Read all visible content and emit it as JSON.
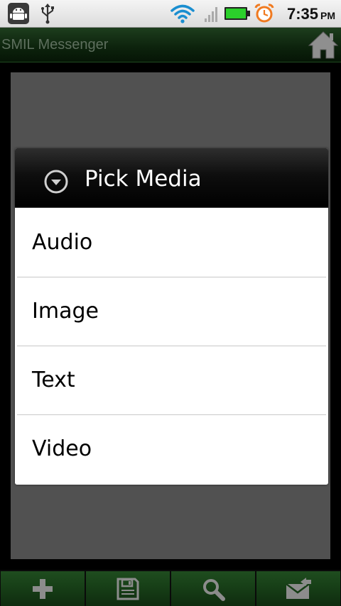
{
  "status_bar": {
    "time": "7:35",
    "ampm": "PM",
    "icons": [
      "android-debug-icon",
      "usb-icon",
      "wifi-icon",
      "signal-icon",
      "battery-icon",
      "alarm-icon"
    ]
  },
  "title_bar": {
    "title": "SMIL Messenger",
    "home_icon": "home-icon"
  },
  "dialog": {
    "title": "Pick Media",
    "icon": "dropdown-circle-icon",
    "items": [
      {
        "label": "Audio"
      },
      {
        "label": "Image"
      },
      {
        "label": "Text"
      },
      {
        "label": "Video"
      }
    ]
  },
  "bottom_bar": {
    "buttons": [
      {
        "icon": "add-icon"
      },
      {
        "icon": "save-icon"
      },
      {
        "icon": "search-icon"
      },
      {
        "icon": "send-mail-icon"
      }
    ]
  },
  "colors": {
    "accent_green": "#163d16",
    "dialog_header": "#000000",
    "panel_gray": "#515151"
  }
}
